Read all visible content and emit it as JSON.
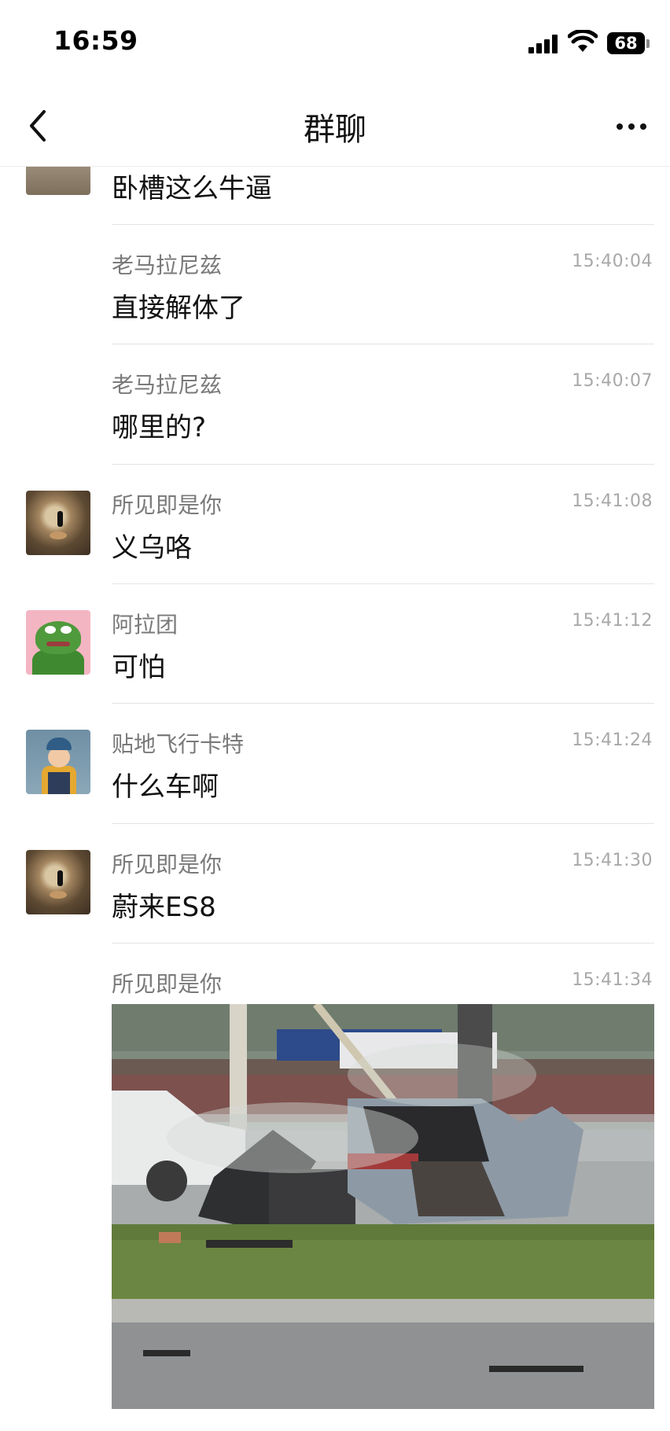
{
  "status_bar": {
    "time": "16:59",
    "battery": "68",
    "icons": [
      "cellular-signal-icon",
      "wifi-icon",
      "battery-icon"
    ]
  },
  "nav": {
    "title": "群聊",
    "back_icon": "chevron-left-icon",
    "more_icon": "more-dots-icon"
  },
  "messages": [
    {
      "name": "",
      "time": "",
      "text": "卧槽这么牛逼",
      "avatar": "partial"
    },
    {
      "name": "老马拉尼兹",
      "time": "15:40:04",
      "text": "直接解体了",
      "avatar": "none"
    },
    {
      "name": "老马拉尼兹",
      "time": "15:40:07",
      "text": "哪里的?",
      "avatar": "none"
    },
    {
      "name": "所见即是你",
      "time": "15:41:08",
      "text": "义乌咯",
      "avatar": "cat"
    },
    {
      "name": "阿拉团",
      "time": "15:41:12",
      "text": "可怕",
      "avatar": "frog"
    },
    {
      "name": "贴地飞行卡特",
      "time": "15:41:24",
      "text": "什么车啊",
      "avatar": "kid"
    },
    {
      "name": "所见即是你",
      "time": "15:41:30",
      "text": "蔚来ES8",
      "avatar": "cat"
    },
    {
      "name": "所见即是你",
      "time": "15:41:34",
      "text": "",
      "avatar": "none",
      "image": "crash-photo"
    }
  ],
  "colors": {
    "name_text": "#7a7a7a",
    "time_text": "#a8a8a8",
    "message_text": "#111111",
    "divider": "#e4e4e4"
  }
}
